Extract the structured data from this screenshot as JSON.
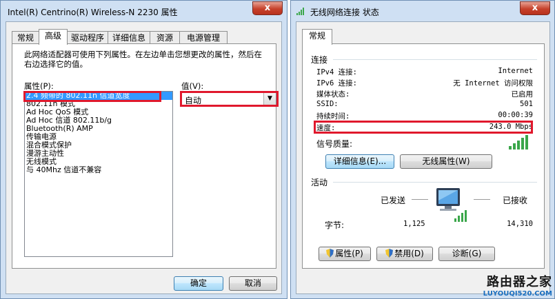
{
  "left_window": {
    "title": "Intel(R) Centrino(R) Wireless-N 2230 属性",
    "close_glyph": "x",
    "tabs": [
      "常规",
      "高级",
      "驱动程序",
      "详细信息",
      "资源",
      "电源管理"
    ],
    "active_tab": "高级",
    "description": "此网络适配器可使用下列属性。在左边单击您想更改的属性，然后在右边选择它的值。",
    "property_label": "属性(P):",
    "properties": [
      "2.4 频带的 802.11n 信道宽度",
      "802.11n 模式",
      "Ad Hoc QoS 模式",
      "Ad Hoc 信道 802.11b/g",
      "Bluetooth(R) AMP",
      "传输电源",
      "混合模式保护",
      "漫游主动性",
      "无线模式",
      "与 40Mhz 信道不兼容"
    ],
    "selected_property": "2.4 频带的 802.11n 信道宽度",
    "value_label": "值(V):",
    "value": "自动",
    "ok_label": "确定",
    "cancel_label": "取消"
  },
  "right_window": {
    "title": "无线网络连接 状态",
    "close_glyph": "x",
    "tabs": [
      "常规"
    ],
    "connection_heading": "连接",
    "rows": [
      {
        "label": "IPv4 连接:",
        "value": "Internet"
      },
      {
        "label": "IPv6 连接:",
        "value": "无 Internet 访问权限"
      },
      {
        "label": "媒体状态:",
        "value": "已启用"
      },
      {
        "label": "SSID:",
        "value": "501"
      },
      {
        "label": "持续时间:",
        "value": "00:00:39"
      },
      {
        "label": "速度:",
        "value": "243.0 Mbps"
      }
    ],
    "signal_label": "信号质量:",
    "signal_bars": 5,
    "details_button": "详细信息(E)...",
    "wireless_props_button": "无线属性(W)",
    "activity_heading": "活动",
    "sent_label": "已发送",
    "received_label": "已接收",
    "bytes_label": "字节:",
    "bytes_sent": "1,125",
    "bytes_received": "14,310",
    "properties_button": "属性(P)",
    "disable_button": "禁用(D)",
    "diagnose_button": "诊断(G)"
  },
  "watermark": {
    "line1": "路由器之家",
    "line2": "LUYOUQI520.COM"
  },
  "colors": {
    "highlight_red": "#e0182c",
    "selection_blue": "#3399ff",
    "signal_green": "#3aa64a"
  }
}
